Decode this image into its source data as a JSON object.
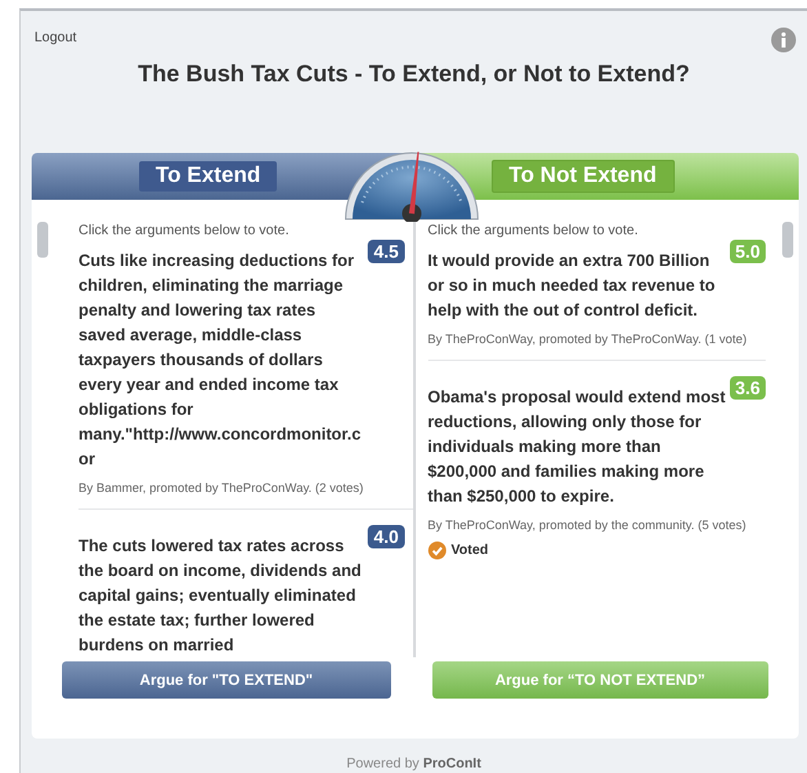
{
  "logout": "Logout",
  "title": "The Bush Tax Cuts - To Extend, or Not to Extend?",
  "sides": [
    {
      "kind": "pro",
      "label": "To Extend",
      "instruction": "Click the arguments below to vote.",
      "button": "Argue for \"TO EXTEND\"",
      "arguments": [
        {
          "score": "4.5",
          "text": "Cuts like increasing deductions for children, eliminating the marriage penalty and lowering tax rates saved average, middle-class taxpayers thousands of dollars every year and ended income tax obligations for many.\"http://www.concordmonitor.cor",
          "byline": "By Bammer, promoted by TheProConWay. (2 votes)",
          "voted": false
        },
        {
          "score": "4.0",
          "text": "The cuts lowered tax rates across the board on income, dividends and capital gains; eventually eliminated the estate tax; further lowered burdens on married",
          "voted": false
        }
      ]
    },
    {
      "kind": "con",
      "label": "To Not Extend",
      "instruction": "Click the arguments below to vote.",
      "button": "Argue for “TO NOT EXTEND”",
      "arguments": [
        {
          "score": "5.0",
          "text": "It would provide an extra 700 Billion or so in much needed tax revenue to help with the out of control deficit.",
          "byline": "By TheProConWay, promoted by TheProConWay. (1 vote)",
          "voted": false
        },
        {
          "score": "3.6",
          "text": "Obama's proposal would extend most reductions, allowing only those for individuals making more than $200,000 and families making more than $250,000 to expire.",
          "byline": "By TheProConWay, promoted by the community. (5 votes)",
          "voted": true,
          "voted_label": "Voted"
        }
      ]
    }
  ],
  "footer": "Powered by **ProConIt**"
}
